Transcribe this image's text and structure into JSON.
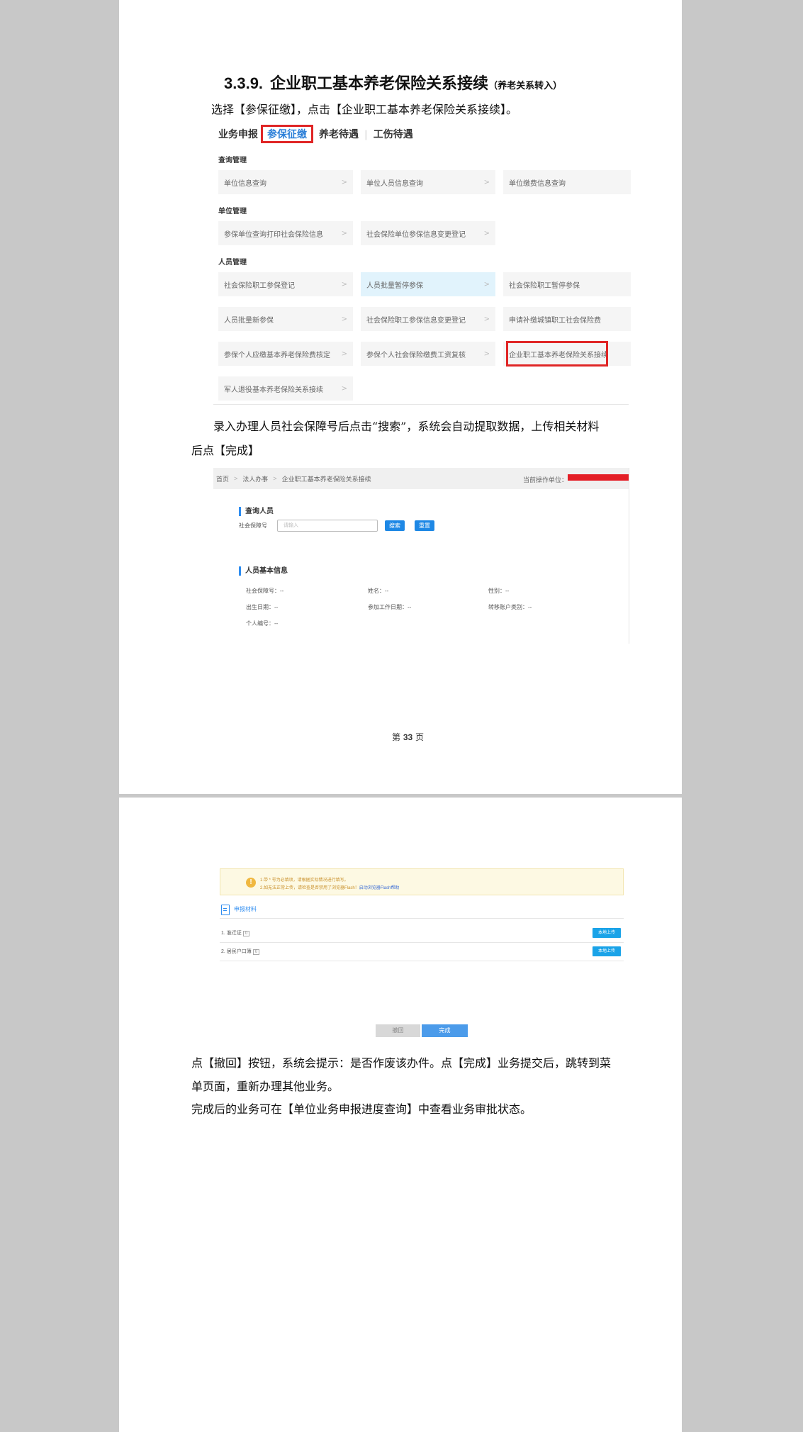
{
  "section": {
    "number": "3.3.9.",
    "title": "企业职工基本养老保险关系接续",
    "subtitle": "（养老关系转入）"
  },
  "paragraphs": {
    "p1": "选择【参保征缴】，点击【企业职工基本养老保险关系接续】。",
    "p2a": "录入办理人员社会保障号后点击“搜索”，系统会自动提取数据，上传相关材料",
    "p2b": "后点【完成】",
    "p3a": "点【撤回】按钮，系统会提示：是否作废该办件。点【完成】业务提交后，跳转到菜",
    "p3b": "单页面，重新办理其他业务。",
    "p4": "完成后的业务可在【单位业务申报进度查询】中查看业务审批状态。"
  },
  "menu": {
    "tabs": [
      "业务申报",
      "参保征缴",
      "养老待遇",
      "工伤待遇"
    ],
    "sections": [
      "查询管理",
      "单位管理",
      "人员管理"
    ],
    "chevron": ">",
    "items": [
      "单位信息查询",
      "单位人员信息查询",
      "单位缴费信息查询",
      "参保单位查询打印社会保险信息",
      "社会保险单位参保信息变更登记",
      "社会保险职工参保登记",
      "人员批量暂停参保",
      "社会保险职工暂停参保",
      "人员批量新参保",
      "社会保险职工参保信息变更登记",
      "申请补缴城镇职工社会保险费",
      "参保个人应缴基本养老保险费核定",
      "参保个人社会保险缴费工资复核",
      "企业职工基本养老保险关系接续",
      "军人退役基本养老保险关系接续"
    ]
  },
  "form": {
    "breadcrumb": [
      "首页",
      "法人办事",
      "企业职工基本养老保险关系接续"
    ],
    "current_unit_label": "当前操作单位：",
    "query_title": "查询人员",
    "ss_label": "社会保障号",
    "ss_placeholder": "请输入",
    "search_btn": "搜索",
    "reset_btn": "重置",
    "info_title": "人员基本信息",
    "fields": [
      "社会保障号：--",
      "姓名：--",
      "性别：--",
      "出生日期：--",
      "参加工作日期：--",
      "转移账户类别：--",
      "个人编号：--"
    ]
  },
  "upload": {
    "notice1": "1.带 * 号为必填项，请根据实际情况进行填写。",
    "notice2": "2.如无法正常上传，请检查是否禁用了浏览器Flash！",
    "notice_link": "启动浏览器Flash帮助",
    "materials_title": "申报材料",
    "rows": [
      {
        "label": "1. 准迁证",
        "tag": "0"
      },
      {
        "label": "2. 居民户口簿",
        "tag": "0"
      }
    ],
    "upload_btn": "本地上传",
    "cancel_btn": "撤回",
    "done_btn": "完成"
  },
  "footer": {
    "pre": "第",
    "num": "33",
    "post": "页"
  }
}
